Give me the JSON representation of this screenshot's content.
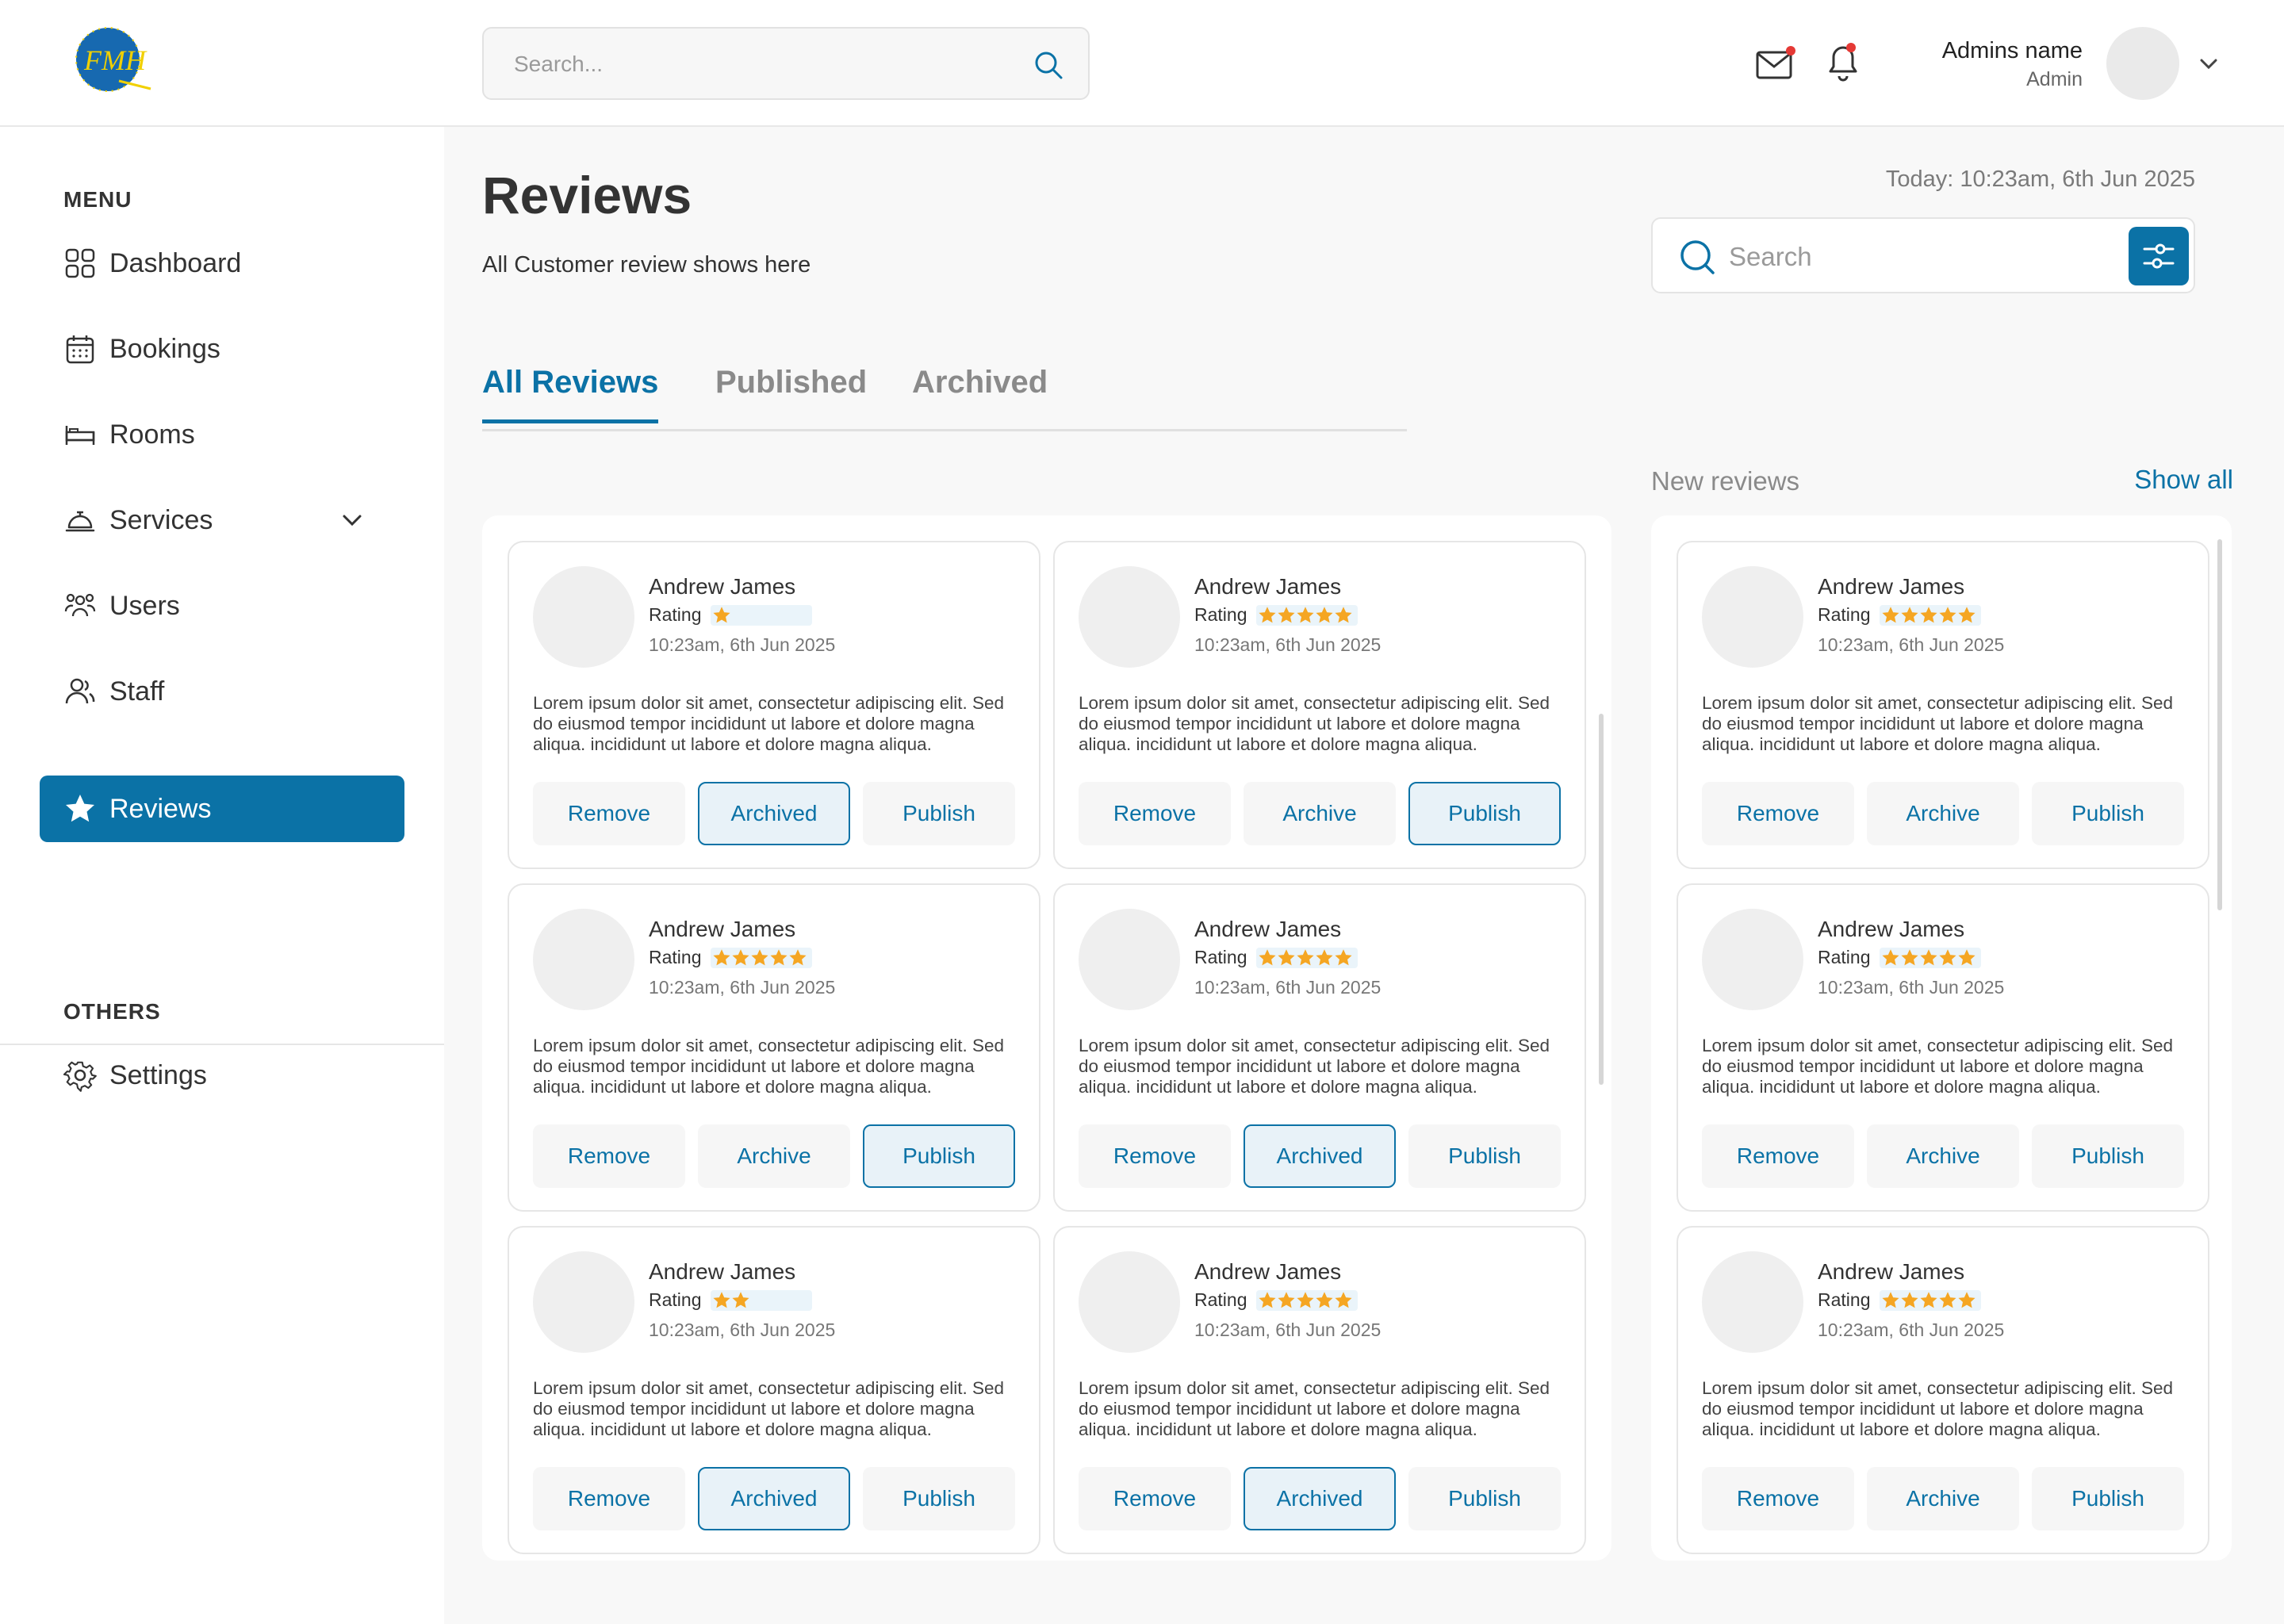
{
  "header": {
    "search_placeholder": "Search...",
    "admin_name": "Admins name",
    "admin_role": "Admin"
  },
  "sidebar": {
    "menu_title": "MENU",
    "others_title": "OTHERS",
    "items": [
      {
        "label": "Dashboard",
        "icon": "grid-icon"
      },
      {
        "label": "Bookings",
        "icon": "calendar-icon"
      },
      {
        "label": "Rooms",
        "icon": "bed-icon"
      },
      {
        "label": "Services",
        "icon": "service-bell-icon"
      },
      {
        "label": "Users",
        "icon": "users-icon"
      },
      {
        "label": "Staff",
        "icon": "staff-icon"
      },
      {
        "label": "Reviews",
        "icon": "star-icon"
      }
    ],
    "settings_label": "Settings"
  },
  "page": {
    "title": "Reviews",
    "subtitle": "All Customer review shows here",
    "today": "Today: 10:23am, 6th Jun 2025",
    "search_placeholder": "Search"
  },
  "tabs": [
    {
      "label": "All Reviews"
    },
    {
      "label": "Published"
    },
    {
      "label": "Archived"
    }
  ],
  "new_reviews": {
    "title": "New reviews",
    "show_all": "Show all"
  },
  "review_text": "Lorem ipsum dolor sit amet, consectetur adipiscing elit. Sed do eiusmod tempor incididunt ut labore et dolore magna aliqua. incididunt ut labore et dolore magna aliqua.",
  "reviews": [
    {
      "name": "Andrew James",
      "rating_label": "Rating",
      "stars": 1,
      "time": "10:23am, 6th Jun 2025",
      "buttons": [
        "Remove",
        "Archived",
        "Publish"
      ],
      "highlight": 1
    },
    {
      "name": "Andrew James",
      "rating_label": "Rating",
      "stars": 5,
      "time": "10:23am, 6th Jun 2025",
      "buttons": [
        "Remove",
        "Archive",
        "Publish"
      ],
      "highlight": 2
    },
    {
      "name": "Andrew James",
      "rating_label": "Rating",
      "stars": 5,
      "time": "10:23am, 6th Jun 2025",
      "buttons": [
        "Remove",
        "Archive",
        "Publish"
      ],
      "highlight": 2
    },
    {
      "name": "Andrew James",
      "rating_label": "Rating",
      "stars": 5,
      "time": "10:23am, 6th Jun 2025",
      "buttons": [
        "Remove",
        "Archived",
        "Publish"
      ],
      "highlight": 1
    },
    {
      "name": "Andrew James",
      "rating_label": "Rating",
      "stars": 2,
      "time": "10:23am, 6th Jun 2025",
      "buttons": [
        "Remove",
        "Archived",
        "Publish"
      ],
      "highlight": 1
    },
    {
      "name": "Andrew James",
      "rating_label": "Rating",
      "stars": 5,
      "time": "10:23am, 6th Jun 2025",
      "buttons": [
        "Remove",
        "Archived",
        "Publish"
      ],
      "highlight": 1
    }
  ],
  "new_review_list": [
    {
      "name": "Andrew James",
      "rating_label": "Rating",
      "stars": 5,
      "time": "10:23am, 6th Jun 2025",
      "buttons": [
        "Remove",
        "Archive",
        "Publish"
      ],
      "highlight": -1
    },
    {
      "name": "Andrew James",
      "rating_label": "Rating",
      "stars": 5,
      "time": "10:23am, 6th Jun 2025",
      "buttons": [
        "Remove",
        "Archive",
        "Publish"
      ],
      "highlight": -1
    },
    {
      "name": "Andrew James",
      "rating_label": "Rating",
      "stars": 5,
      "time": "10:23am, 6th Jun 2025",
      "buttons": [
        "Remove",
        "Archive",
        "Publish"
      ],
      "highlight": -1
    }
  ],
  "colors": {
    "accent": "#0b72a6",
    "star": "#f5a623",
    "notification_dot": "#e53935"
  }
}
